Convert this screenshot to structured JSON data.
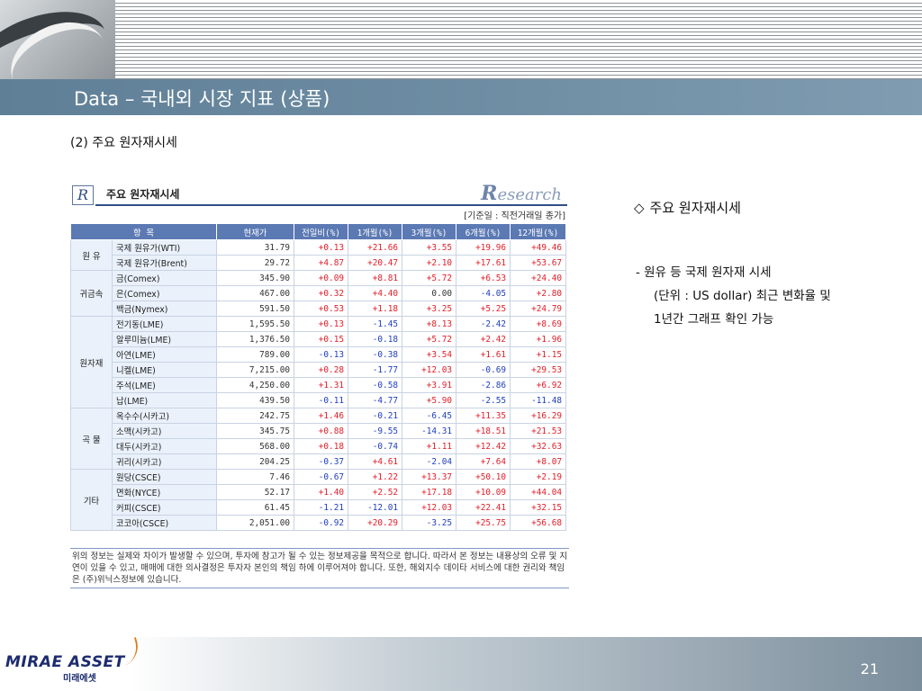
{
  "slide": {
    "title": "Data – 국내외 시장 지표 (상품)",
    "section_title": "(2) 주요 원자재시세",
    "page_number": "21"
  },
  "card": {
    "logo_letter": "R",
    "title": "주요 원자재시세",
    "brand_initial": "R",
    "brand_rest": "esearch",
    "basis_note": "[기준일 : 직전거래일 종가]"
  },
  "chart_data": {
    "type": "table",
    "columns": [
      "항 목",
      "현재가",
      "전일비(%)",
      "1개월(%)",
      "3개월(%)",
      "6개월(%)",
      "12개월(%)"
    ],
    "groups": [
      {
        "group": "원 유",
        "rows": [
          {
            "item": "국제 원유가(WTI)",
            "price": "31.79",
            "d1": "+0.13",
            "m1": "+21.66",
            "m3": "+3.55",
            "m6": "+19.96",
            "m12": "+49.46"
          },
          {
            "item": "국제 원유가(Brent)",
            "price": "29.72",
            "d1": "+4.87",
            "m1": "+20.47",
            "m3": "+2.10",
            "m6": "+17.61",
            "m12": "+53.67"
          }
        ]
      },
      {
        "group": "귀금속",
        "rows": [
          {
            "item": "금(Comex)",
            "price": "345.90",
            "d1": "+0.09",
            "m1": "+8.81",
            "m3": "+5.72",
            "m6": "+6.53",
            "m12": "+24.40"
          },
          {
            "item": "은(Comex)",
            "price": "467.00",
            "d1": "+0.32",
            "m1": "+4.40",
            "m3": "0.00",
            "m6": "-4.05",
            "m12": "+2.80"
          },
          {
            "item": "백금(Nymex)",
            "price": "591.50",
            "d1": "+0.53",
            "m1": "+1.18",
            "m3": "+3.25",
            "m6": "+5.25",
            "m12": "+24.79"
          }
        ]
      },
      {
        "group": "원자재",
        "rows": [
          {
            "item": "전기동(LME)",
            "price": "1,595.50",
            "d1": "+0.13",
            "m1": "-1.45",
            "m3": "+8.13",
            "m6": "-2.42",
            "m12": "+8.69"
          },
          {
            "item": "알루미늄(LME)",
            "price": "1,376.50",
            "d1": "+0.15",
            "m1": "-0.18",
            "m3": "+5.72",
            "m6": "+2.42",
            "m12": "+1.96"
          },
          {
            "item": "아연(LME)",
            "price": "789.00",
            "d1": "-0.13",
            "m1": "-0.38",
            "m3": "+3.54",
            "m6": "+1.61",
            "m12": "+1.15"
          },
          {
            "item": "니켈(LME)",
            "price": "7,215.00",
            "d1": "+0.28",
            "m1": "-1.77",
            "m3": "+12.03",
            "m6": "-0.69",
            "m12": "+29.53"
          },
          {
            "item": "주석(LME)",
            "price": "4,250.00",
            "d1": "+1.31",
            "m1": "-0.58",
            "m3": "+3.91",
            "m6": "-2.86",
            "m12": "+6.92"
          },
          {
            "item": "납(LME)",
            "price": "439.50",
            "d1": "-0.11",
            "m1": "-4.77",
            "m3": "+5.90",
            "m6": "-2.55",
            "m12": "-11.48"
          }
        ]
      },
      {
        "group": "곡 물",
        "rows": [
          {
            "item": "옥수수(시카고)",
            "price": "242.75",
            "d1": "+1.46",
            "m1": "-0.21",
            "m3": "-6.45",
            "m6": "+11.35",
            "m12": "+16.29"
          },
          {
            "item": "소맥(시카고)",
            "price": "345.75",
            "d1": "+0.88",
            "m1": "-9.55",
            "m3": "-14.31",
            "m6": "+18.51",
            "m12": "+21.53"
          },
          {
            "item": "대두(시카고)",
            "price": "568.00",
            "d1": "+0.18",
            "m1": "-0.74",
            "m3": "+1.11",
            "m6": "+12.42",
            "m12": "+32.63"
          },
          {
            "item": "귀리(시카고)",
            "price": "204.25",
            "d1": "-0.37",
            "m1": "+4.61",
            "m3": "-2.04",
            "m6": "+7.64",
            "m12": "+8.07"
          }
        ]
      },
      {
        "group": "기타",
        "rows": [
          {
            "item": "원당(CSCE)",
            "price": "7.46",
            "d1": "-0.67",
            "m1": "+1.22",
            "m3": "+13.37",
            "m6": "+50.10",
            "m12": "+2.19"
          },
          {
            "item": "면화(NYCE)",
            "price": "52.17",
            "d1": "+1.40",
            "m1": "+2.52",
            "m3": "+17.18",
            "m6": "+10.09",
            "m12": "+44.04"
          },
          {
            "item": "커피(CSCE)",
            "price": "61.45",
            "d1": "-1.21",
            "m1": "-12.01",
            "m3": "+12.03",
            "m6": "+22.41",
            "m12": "+32.15"
          },
          {
            "item": "코코아(CSCE)",
            "price": "2,051.00",
            "d1": "-0.92",
            "m1": "+20.29",
            "m3": "-3.25",
            "m6": "+25.75",
            "m12": "+56.68"
          }
        ]
      }
    ]
  },
  "disclaimer": "위의 정보는 실제와 차이가 발생할 수 있으며, 투자에 참고가 될 수 있는 정보제공을 목적으로 합니다. 따라서 본 정보는 내용상의 오류 및 지연이 있을 수 있고, 매매에 대한 의사결정은 투자자 본인의 책임 하에 이루어져야 합니다. 또한, 해외지수 데이타 서비스에 대한 권리와 책임은 (주)위닉스정보에 있습니다.",
  "notes": {
    "diamond": "◇",
    "heading": "주요 원자재시세",
    "line1": "- 원유 등 국제 원자재 시세",
    "line2": "(단위 : US dollar) 최근 변화율 및",
    "line3": "1년간 그래프 확인 가능"
  },
  "footer": {
    "logo_main": "MIRAE ASSET",
    "logo_sub": "미래에셋"
  },
  "colors": {
    "positive": "#e2202a",
    "negative": "#1f3fbf",
    "header_blue": "#5b79b3",
    "title_bar": "#6f8ea4"
  }
}
